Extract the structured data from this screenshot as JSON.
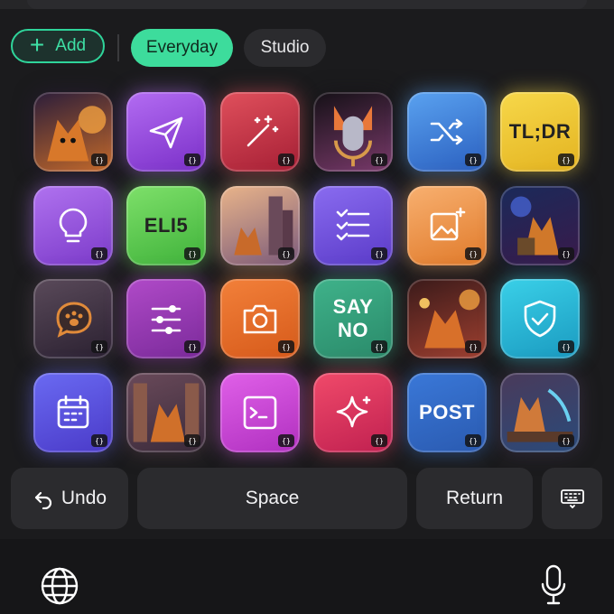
{
  "category_bar": {
    "add_label": "Add",
    "tabs": [
      {
        "label": "Everyday",
        "active": true
      },
      {
        "label": "Studio",
        "active": false
      }
    ],
    "accent": "#3ddc9c"
  },
  "badge_label": "{}",
  "tiles": [
    {
      "name": "fox-portrait-tile",
      "kind": "image",
      "icon": "fox-with-glowing-orb-image",
      "colors": [
        "#2b1d3a",
        "#c46a2a"
      ]
    },
    {
      "name": "send-prompt-tile",
      "kind": "icon",
      "icon": "paper-plane-icon",
      "colors": [
        "#b36cf2",
        "#7a2fc8"
      ]
    },
    {
      "name": "magic-wand-prompt-tile",
      "kind": "icon",
      "icon": "magic-wand-icon",
      "colors": [
        "#e0505c",
        "#a61f35"
      ]
    },
    {
      "name": "fox-microphone-tile",
      "kind": "image",
      "icon": "fox-microphone-image",
      "colors": [
        "#141016",
        "#7a3a6a"
      ]
    },
    {
      "name": "shuffle-prompt-tile",
      "kind": "icon",
      "icon": "shuffle-icon",
      "colors": [
        "#5aa2f0",
        "#2a5fbf"
      ]
    },
    {
      "name": "tldr-prompt-tile",
      "kind": "text",
      "text": "TL;DR",
      "dark": true,
      "colors": [
        "#f7d84a",
        "#e3b320"
      ]
    },
    {
      "name": "idea-prompt-tile",
      "kind": "icon",
      "icon": "lightbulb-icon",
      "colors": [
        "#b072ef",
        "#7b3ac9"
      ]
    },
    {
      "name": "eli5-prompt-tile",
      "kind": "text",
      "text": "ELI5",
      "dark": true,
      "colors": [
        "#7ee06a",
        "#3fb23a"
      ]
    },
    {
      "name": "fox-city-tile",
      "kind": "image",
      "icon": "fox-city-image",
      "colors": [
        "#e9b48a",
        "#7a5a7a"
      ]
    },
    {
      "name": "list-prompt-tile",
      "kind": "icon",
      "icon": "checklist-icon",
      "colors": [
        "#8a6cf0",
        "#5a3ac8"
      ]
    },
    {
      "name": "image-edit-prompt-tile",
      "kind": "icon",
      "icon": "image-sparkle-icon",
      "colors": [
        "#f8b070",
        "#e07a2a"
      ]
    },
    {
      "name": "fox-wizard-tile",
      "kind": "image",
      "icon": "fox-wizard-image",
      "colors": [
        "#1a2a5a",
        "#3a1a4a"
      ]
    },
    {
      "name": "paw-chat-tile",
      "kind": "icon",
      "icon": "paw-chat-bubble-icon",
      "colors": [
        "#5a4a5a",
        "#2a2030"
      ]
    },
    {
      "name": "settings-prompt-tile",
      "kind": "icon",
      "icon": "sliders-icon",
      "colors": [
        "#b04ac8",
        "#7a2a9a"
      ]
    },
    {
      "name": "camera-prompt-tile",
      "kind": "icon",
      "icon": "camera-icon",
      "colors": [
        "#f2803a",
        "#d65a1a"
      ]
    },
    {
      "name": "say-no-prompt-tile",
      "kind": "text",
      "text": "SAY NO",
      "dark": false,
      "colors": [
        "#3fb28a",
        "#2a8a6a"
      ]
    },
    {
      "name": "fox-lab-tile",
      "kind": "image",
      "icon": "fox-lab-image",
      "colors": [
        "#3a1a1a",
        "#a04030"
      ]
    },
    {
      "name": "shield-prompt-tile",
      "kind": "icon",
      "icon": "shield-check-icon",
      "colors": [
        "#3ad0e8",
        "#1a9ac0"
      ]
    },
    {
      "name": "calendar-prompt-tile",
      "kind": "icon",
      "icon": "calendar-icon",
      "colors": [
        "#6a6af2",
        "#4a3ac8"
      ]
    },
    {
      "name": "fox-library-tile",
      "kind": "image",
      "icon": "fox-library-image",
      "colors": [
        "#6a4a5a",
        "#3a2a3a"
      ]
    },
    {
      "name": "terminal-prompt-tile",
      "kind": "icon",
      "icon": "terminal-window-icon",
      "colors": [
        "#e060e8",
        "#b030c0"
      ]
    },
    {
      "name": "sparkle-prompt-tile",
      "kind": "icon",
      "icon": "sparkle-icon",
      "colors": [
        "#f04a6a",
        "#c02050"
      ]
    },
    {
      "name": "post-prompt-tile",
      "kind": "text",
      "text": "POST",
      "dark": false,
      "colors": [
        "#3a78d8",
        "#2a5ab0"
      ]
    },
    {
      "name": "fox-desk-tile",
      "kind": "image",
      "icon": "fox-desk-image",
      "colors": [
        "#4a3a5a",
        "#2a4a7a"
      ]
    }
  ],
  "keys": {
    "undo_label": "Undo",
    "space_label": "Space",
    "return_label": "Return"
  },
  "icons": {
    "undo": "undo-arrow-icon",
    "keyboard": "keyboard-icon",
    "globe": "globe-icon",
    "mic": "microphone-icon"
  }
}
